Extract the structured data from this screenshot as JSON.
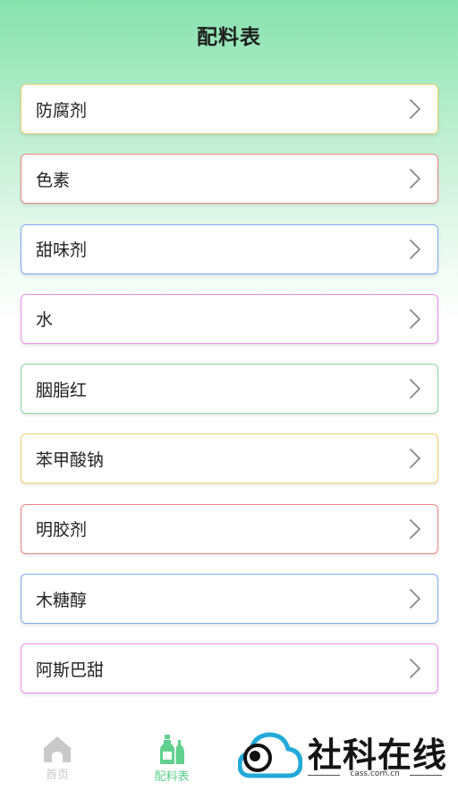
{
  "header": {
    "title": "配料表"
  },
  "items": [
    {
      "label": "防腐剂",
      "color": "#f3d36b"
    },
    {
      "label": "色素",
      "color": "#ef8585"
    },
    {
      "label": "甜味剂",
      "color": "#7fa9ee"
    },
    {
      "label": "水",
      "color": "#ee8ee6"
    },
    {
      "label": "胭脂红",
      "color": "#8ad8a6"
    },
    {
      "label": "苯甲酸钠",
      "color": "#f3d36b"
    },
    {
      "label": "明胶剂",
      "color": "#ef8585"
    },
    {
      "label": "木糖醇",
      "color": "#7fa9ee"
    },
    {
      "label": "阿斯巴甜",
      "color": "#ee8ee6"
    }
  ],
  "tabs": [
    {
      "label": "首页",
      "icon": "home-icon",
      "active": false
    },
    {
      "label": "配料表",
      "icon": "bottles-icon",
      "active": true
    }
  ],
  "colors": {
    "tab_active": "#5fd08e",
    "tab_inactive": "#c9c9c9",
    "chevron": "#888888"
  },
  "watermark": {
    "title": "社科在线",
    "url": "cass.com.cn"
  }
}
